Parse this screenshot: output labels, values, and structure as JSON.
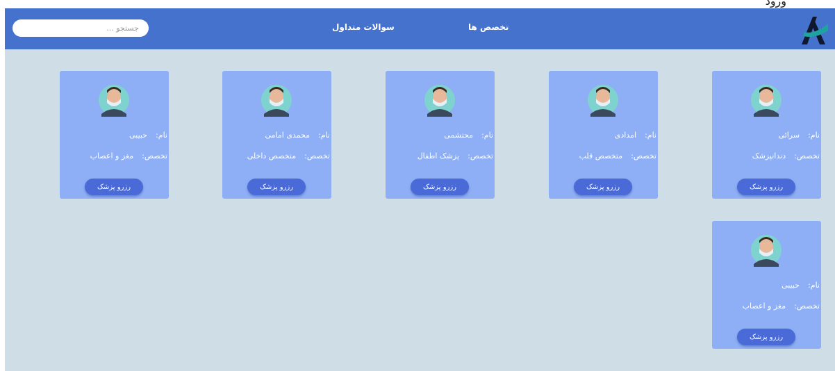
{
  "corner_text": "ورود",
  "header": {
    "nav": [
      {
        "label": "تخصص ها"
      },
      {
        "label": "سوالات متداول"
      }
    ],
    "search_placeholder": "جستجو ..."
  },
  "labels": {
    "name": "نام:",
    "specialty": "تخصص:",
    "book": "رزرو پزشک"
  },
  "doctors": [
    {
      "name": "سرائی",
      "specialty": "دندانپزشک"
    },
    {
      "name": "امدادی",
      "specialty": "متخصص قلب"
    },
    {
      "name": "محتشمی",
      "specialty": "پزشک اطفال"
    },
    {
      "name": "محمدی امامی",
      "specialty": "متخصص داخلی"
    },
    {
      "name": "حبیبی",
      "specialty": "مغز و اعصاب"
    },
    {
      "name": "حبیبی",
      "specialty": "مغز و اعصاب"
    }
  ],
  "colors": {
    "header": "#4472cc",
    "background": "#cfdde6",
    "card": "#8eaff5",
    "button": "#4a6ad8"
  }
}
